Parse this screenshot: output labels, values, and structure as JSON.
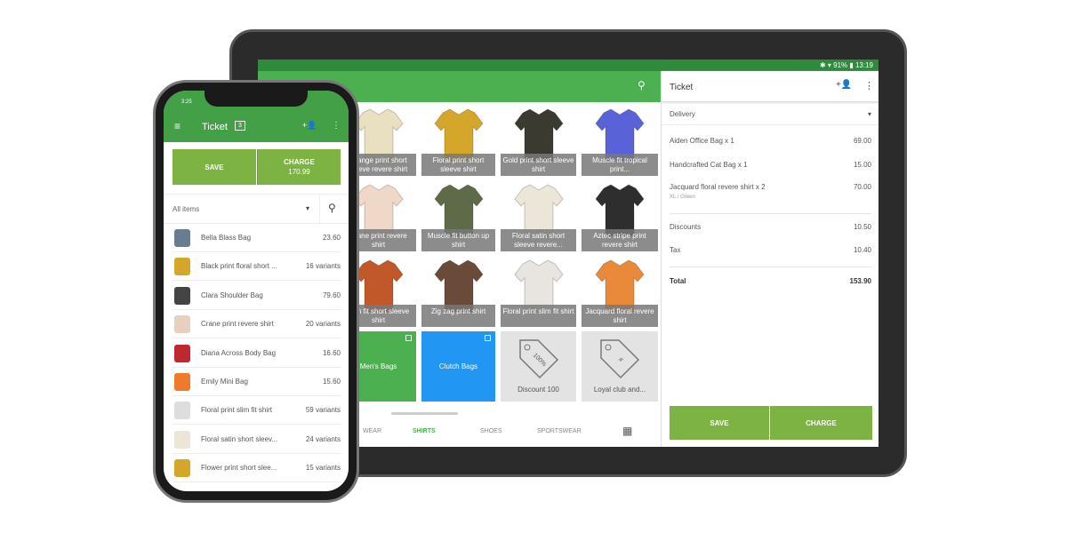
{
  "tablet": {
    "status": "✱ ▾ 91% ▮ 13:19",
    "grid": [
      {
        "label": "Orange print short sleeve revere shirt",
        "color": "#e8e0c0"
      },
      {
        "label": "Floral print short sleeve shirt",
        "color": "#d4a62a"
      },
      {
        "label": "Gold print short sleeve shirt",
        "color": "#3a3a30"
      },
      {
        "label": "Muscle fit tropical print...",
        "color": "#5a62d8"
      },
      {
        "label": "Crane print revere shirt",
        "color": "#f0d8c8"
      },
      {
        "label": "Muscle fit button up shirt",
        "color": "#5e6a48"
      },
      {
        "label": "Floral satin short sleeve revere...",
        "color": "#ece6d8"
      },
      {
        "label": "Aztec stripe print revere shirt",
        "color": "#2e2e2e"
      },
      {
        "label": "Slim fit short sleeve shirt",
        "color": "#c0582a"
      },
      {
        "label": "Zig zag print shirt",
        "color": "#6a4a38"
      },
      {
        "label": "Floral print slim fit shirt",
        "color": "#e8e4e0"
      },
      {
        "label": "Jacquard floral revere shirt",
        "color": "#e88a3a"
      }
    ],
    "categories": [
      {
        "label": "Men's Bags",
        "color": "#4caf50"
      },
      {
        "label": "Clutch Bags",
        "color": "#2196f3"
      }
    ],
    "discounts": [
      {
        "label": "Discount 100",
        "tag": "100%"
      },
      {
        "label": "Loyal club and...",
        "tag": "#"
      }
    ],
    "tabs": [
      "WEAR",
      "SHIRTS",
      "SHOES",
      "SPORTSWEAR"
    ],
    "active_tab": "SHIRTS",
    "ticket": {
      "title": "Ticket",
      "dining": "Delivery",
      "items": [
        {
          "name": "Aiden Office Bag x 1",
          "price": "69.00"
        },
        {
          "name": "Handcrafted Cat Bag x 1",
          "price": "15.00"
        },
        {
          "name": "Jacquard floral revere shirt x 2",
          "price": "70.00",
          "sub": "XL / Green"
        }
      ],
      "discounts_label": "Discounts",
      "discounts": "10.50",
      "tax_label": "Tax",
      "tax": "10.40",
      "total_label": "Total",
      "total": "153.90",
      "save": "SAVE",
      "charge": "CHARGE"
    }
  },
  "phone": {
    "time": "3:25",
    "title": "Ticket",
    "ticket_count": "3",
    "save": "SAVE",
    "charge": "CHARGE",
    "charge_amount": "170.99",
    "filter": "All items",
    "items": [
      {
        "name": "Bella Blass Bag",
        "price": "23.60",
        "color": "#6a7c90"
      },
      {
        "name": "Black print floral short ...",
        "price": "16 variants",
        "color": "#d4a62a"
      },
      {
        "name": "Clara Shoulder Bag",
        "price": "79.60",
        "color": "#444"
      },
      {
        "name": "Crane print revere shirt",
        "price": "20 variants",
        "color": "#e8d0c0"
      },
      {
        "name": "Diana Across Body Bag",
        "price": "16.60",
        "color": "#c02830"
      },
      {
        "name": "Emily Mini Bag",
        "price": "15.60",
        "color": "#ee7a2a"
      },
      {
        "name": "Floral print slim fit shirt",
        "price": "59 variants",
        "color": "#ddd"
      },
      {
        "name": "Floral satin short sleev...",
        "price": "24 variants",
        "color": "#ece6d8"
      },
      {
        "name": "Flower print short slee...",
        "price": "15 variants",
        "color": "#d4a62a"
      }
    ]
  },
  "colors": {
    "primary": "#4caf50",
    "button": "#7cb342",
    "accent_blue": "#2196f3"
  }
}
